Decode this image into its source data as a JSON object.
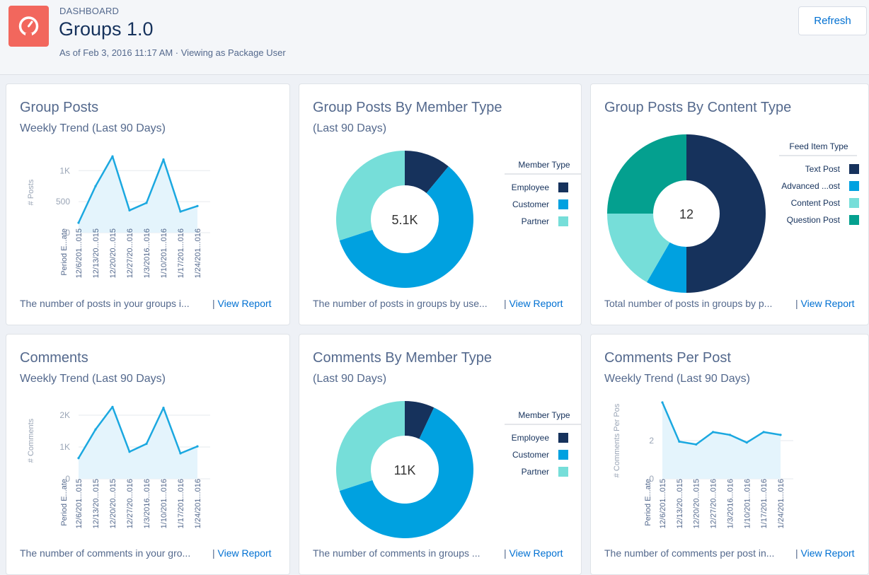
{
  "header": {
    "label": "DASHBOARD",
    "title": "Groups 1.0",
    "subtitle": "As of Feb 3, 2016 11:17 AM · Viewing as Package User",
    "refresh_label": "Refresh",
    "icon": "gauge-icon",
    "icon_color": "#f2675d"
  },
  "colors": {
    "accent": "#0070d2",
    "line": "#1ba8e0",
    "area": "#e4f4fc",
    "employee": "#16325c",
    "customer": "#00a1e0",
    "partner": "#76ded9",
    "question": "#04a08f"
  },
  "cards": [
    {
      "title": "Group Posts",
      "subtitle": "Weekly Trend (Last 90 Days)",
      "footer": "The number of posts in your groups i...",
      "link": "View Report"
    },
    {
      "title": "Group Posts By Member Type",
      "subtitle": "(Last 90 Days)",
      "footer": "The number of posts in groups by use...",
      "link": "View Report"
    },
    {
      "title": "Group Posts By Content Type",
      "subtitle": "",
      "footer": "Total number of posts in groups by p...",
      "link": "View Report"
    },
    {
      "title": "Comments",
      "subtitle": "Weekly Trend (Last 90 Days)",
      "footer": "The number of comments in your gro...",
      "link": "View Report"
    },
    {
      "title": "Comments By Member Type",
      "subtitle": "(Last 90 Days)",
      "footer": "The number of comments in groups ...",
      "link": "View Report"
    },
    {
      "title": "Comments Per Post",
      "subtitle": "Weekly Trend (Last 90 Days)",
      "footer": "The number of comments per post in...",
      "link": "View Report"
    }
  ],
  "chart_data": [
    {
      "type": "area",
      "ylabel": "# Posts",
      "x_axis_title": "Period E...ate",
      "categories": [
        "12/6/201...015",
        "12/13/20...015",
        "12/20/20...015",
        "12/27/20...016",
        "1/3/2016...016",
        "1/10/201...016",
        "1/17/201...016",
        "1/24/201...016"
      ],
      "values": [
        160,
        750,
        1230,
        360,
        480,
        1180,
        340,
        430
      ],
      "yticks": [
        "0",
        "500",
        "1K"
      ],
      "ytick_values": [
        0,
        500,
        1000
      ],
      "ylim": [
        0,
        1300
      ],
      "grid": true
    },
    {
      "type": "pie",
      "center_label": "5.1K",
      "legend_title": "Member Type",
      "legend_position": "right",
      "slices": [
        {
          "name": "Employee",
          "value": 11,
          "color": "#16325c"
        },
        {
          "name": "Customer",
          "value": 59,
          "color": "#00a1e0"
        },
        {
          "name": "Partner",
          "value": 30,
          "color": "#76ded9"
        }
      ]
    },
    {
      "type": "pie",
      "center_label": "12",
      "legend_title": "Feed Item Type",
      "legend_position": "right",
      "slices": [
        {
          "name": "Text Post",
          "value": 6,
          "color": "#16325c"
        },
        {
          "name": "Advanced ...ost",
          "value": 1,
          "color": "#00a1e0"
        },
        {
          "name": "Content Post",
          "value": 2,
          "color": "#76ded9"
        },
        {
          "name": "Question Post",
          "value": 3,
          "color": "#04a08f"
        }
      ]
    },
    {
      "type": "area",
      "ylabel": "# Comments",
      "x_axis_title": "Period E...ate",
      "categories": [
        "12/6/201...015",
        "12/13/20...015",
        "12/20/20...015",
        "12/27/20...016",
        "1/3/2016...016",
        "1/10/201...016",
        "1/17/201...016",
        "1/24/201...016"
      ],
      "values": [
        650,
        1550,
        2260,
        850,
        1100,
        2230,
        800,
        1020
      ],
      "yticks": [
        "0",
        "1K",
        "2K"
      ],
      "ytick_values": [
        0,
        1000,
        2000
      ],
      "ylim": [
        0,
        2400
      ],
      "grid": true
    },
    {
      "type": "pie",
      "center_label": "11K",
      "legend_title": "Member Type",
      "legend_position": "right",
      "slices": [
        {
          "name": "Employee",
          "value": 7,
          "color": "#16325c"
        },
        {
          "name": "Customer",
          "value": 63,
          "color": "#00a1e0"
        },
        {
          "name": "Partner",
          "value": 30,
          "color": "#76ded9"
        }
      ]
    },
    {
      "type": "area",
      "ylabel": "# Comments Per Pos",
      "x_axis_title": "Period E...ate",
      "categories": [
        "12/6/201...015",
        "12/13/20...015",
        "12/20/20...015",
        "12/27/20...016",
        "1/3/2016...016",
        "1/10/201...016",
        "1/17/201...016",
        "1/24/201...016"
      ],
      "values": [
        4,
        1.95,
        1.8,
        2.45,
        2.3,
        1.9,
        2.45,
        2.3
      ],
      "yticks": [
        "0",
        "2"
      ],
      "ytick_values": [
        0,
        2
      ],
      "ylim": [
        0,
        4
      ],
      "grid": true
    }
  ]
}
